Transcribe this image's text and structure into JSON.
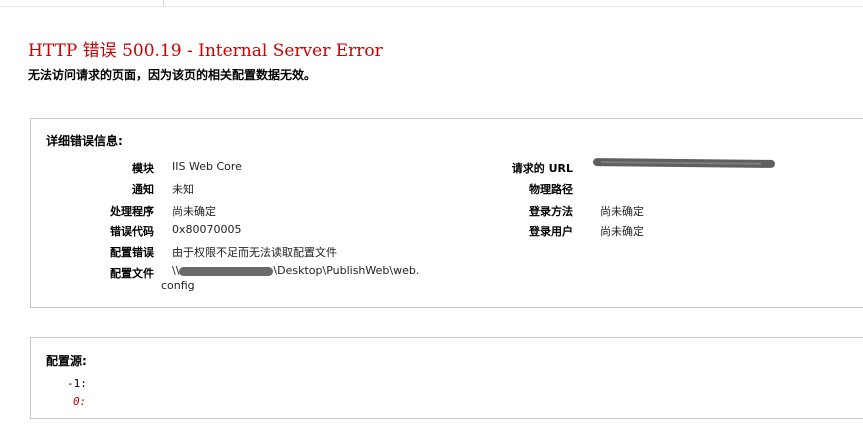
{
  "error": {
    "title": "HTTP 错误 500.19 - Internal Server Error",
    "subtitle": "无法访问请求的页面，因为该页的相关配置数据无效。"
  },
  "details": {
    "heading": "详细错误信息:",
    "left": [
      {
        "label": "模块",
        "value": "IIS Web Core"
      },
      {
        "label": "通知",
        "value": "未知"
      },
      {
        "label": "处理程序",
        "value": "尚未确定"
      },
      {
        "label": "错误代码",
        "value": "0x80070005"
      },
      {
        "label": "配置错误",
        "value": "由于权限不足而无法读取配置文件"
      },
      {
        "label": "配置文件",
        "value_prefix": "\\\\",
        "value_suffix": "\\Desktop\\PublishWeb\\web.",
        "value_line2": "config"
      }
    ],
    "right": [
      {
        "label": "请求的 URL",
        "value": ""
      },
      {
        "label": "物理路径",
        "value": ""
      },
      {
        "label": "登录方法",
        "value": "尚未确定"
      },
      {
        "label": "登录用户",
        "value": "尚未确定"
      }
    ]
  },
  "config_source": {
    "heading": "配置源:",
    "lines": [
      "-1:",
      "0:"
    ]
  },
  "colors": {
    "error_red": "#cc0000",
    "border": "#c8c8c8",
    "redaction": "#5f5f5f"
  }
}
